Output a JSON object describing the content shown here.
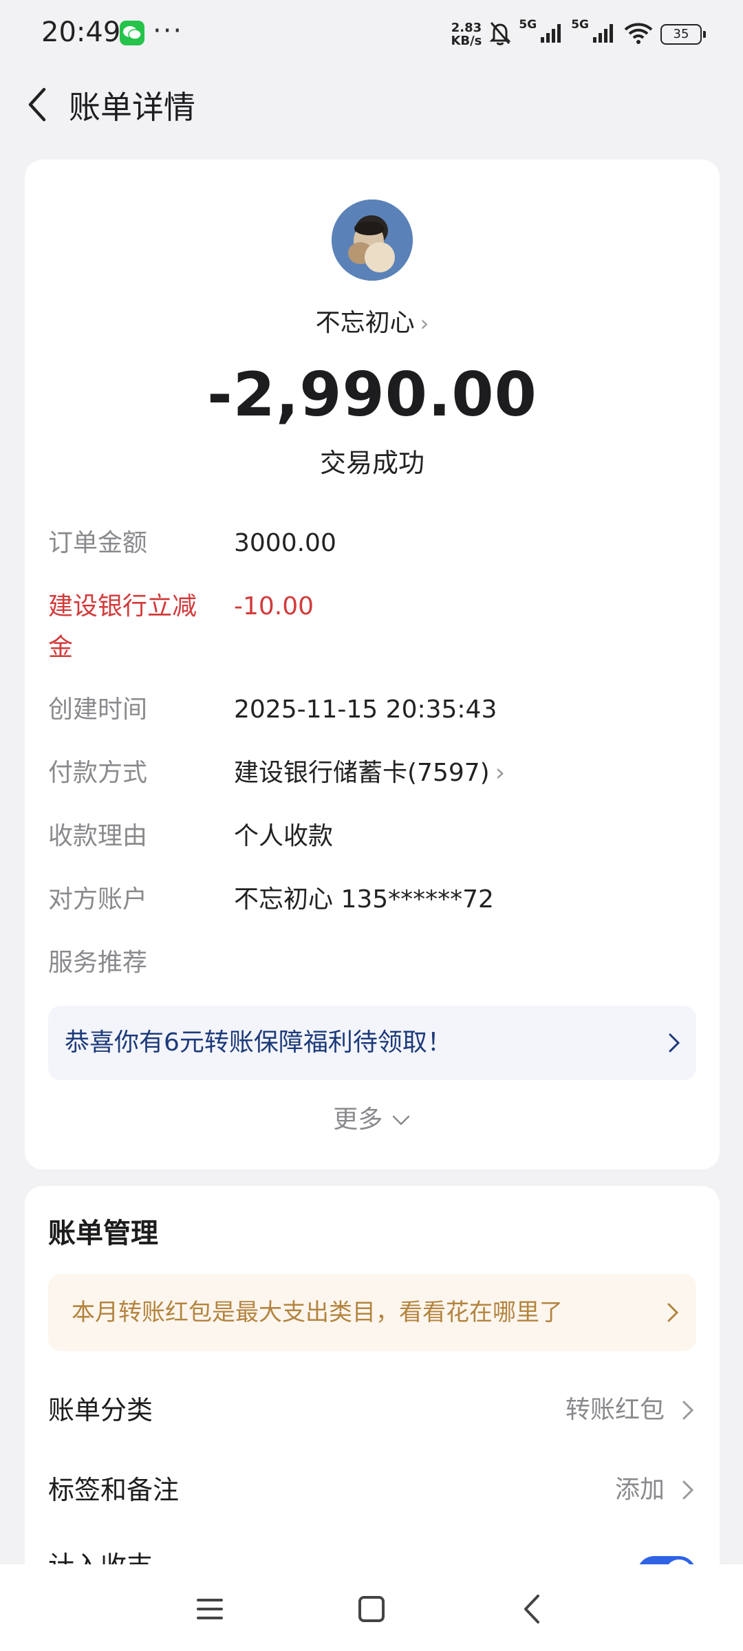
{
  "status_bar": {
    "time": "20:49",
    "notification_app_icon": "wechat-icon",
    "more": "···",
    "net_speed_value": "2.83",
    "net_speed_unit": "KB/s",
    "net_type_1": "5G",
    "net_type_2": "5G",
    "battery": "35"
  },
  "header": {
    "title": "账单详情"
  },
  "summary": {
    "payee": "不忘初心",
    "amount": "-2,990.00",
    "status": "交易成功"
  },
  "details": [
    {
      "label": "订单金额",
      "value": "3000.00"
    },
    {
      "label": "建设银行立减金",
      "value": "-10.00"
    },
    {
      "label": "创建时间",
      "value": "2025-11-15 20:35:43"
    },
    {
      "label": "付款方式",
      "value": "建设银行储蓄卡(7597)"
    },
    {
      "label": "收款理由",
      "value": "个人收款"
    },
    {
      "label": "对方账户",
      "value": "不忘初心 135******72"
    },
    {
      "label": "服务推荐",
      "value": ""
    }
  ],
  "promo": {
    "text": "恭喜你有6元转账保障福利待领取！"
  },
  "more_label": "更多",
  "bill_management": {
    "title": "账单管理",
    "tip": "本月转账红包是最大支出类目，看看花在哪里了",
    "rows": [
      {
        "label": "账单分类",
        "value": "转账红包"
      },
      {
        "label": "标签和备注",
        "value": "添加"
      },
      {
        "label": "计入收支",
        "toggle_on": true
      }
    ]
  },
  "colors": {
    "accent_blue": "#2e63e6",
    "discount_red": "#d23a3a",
    "tip_gold": "#b3843f",
    "promo_blue": "#1d3a7a"
  }
}
